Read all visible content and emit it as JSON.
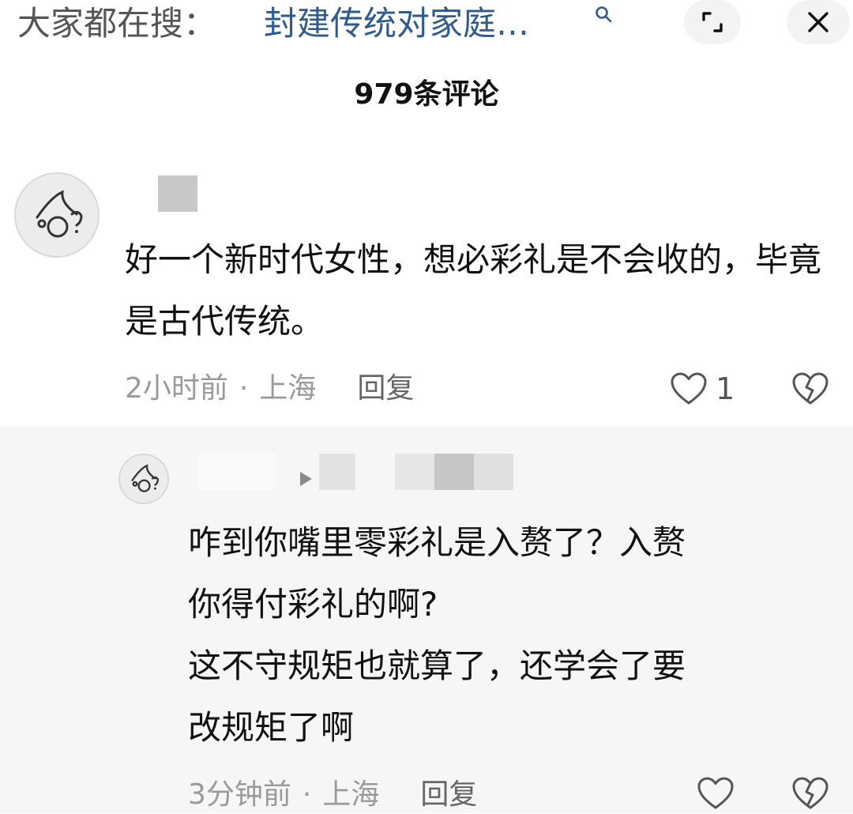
{
  "search_bar": {
    "prefix": "大家都在搜：",
    "query": "封建传统对家庭…",
    "icon": "search-icon"
  },
  "header": {
    "comment_count_label": "979条评论",
    "expand_icon": "expand-icon",
    "close_icon": "close-icon"
  },
  "comments": [
    {
      "text": "好一个新时代女性，想必彩礼是不会收的，毕竟是古代传统。",
      "time": "2小时前",
      "separator": "·",
      "location": "上海",
      "reply_label": "回复",
      "likes": "1"
    }
  ],
  "replies": [
    {
      "lines": [
        "咋到你嘴里零彩礼是入赘了？入赘",
        "你得付彩礼的啊?",
        "这不守规矩也就算了，还学会了要",
        "改规矩了啊"
      ],
      "time": "3分钟前",
      "separator": "·",
      "location": "上海",
      "reply_label": "回复"
    }
  ],
  "colors": {
    "link_blue": "#2e5a8c",
    "meta_gray": "#9a9a9a",
    "reply_background": "#f5f6f8"
  }
}
